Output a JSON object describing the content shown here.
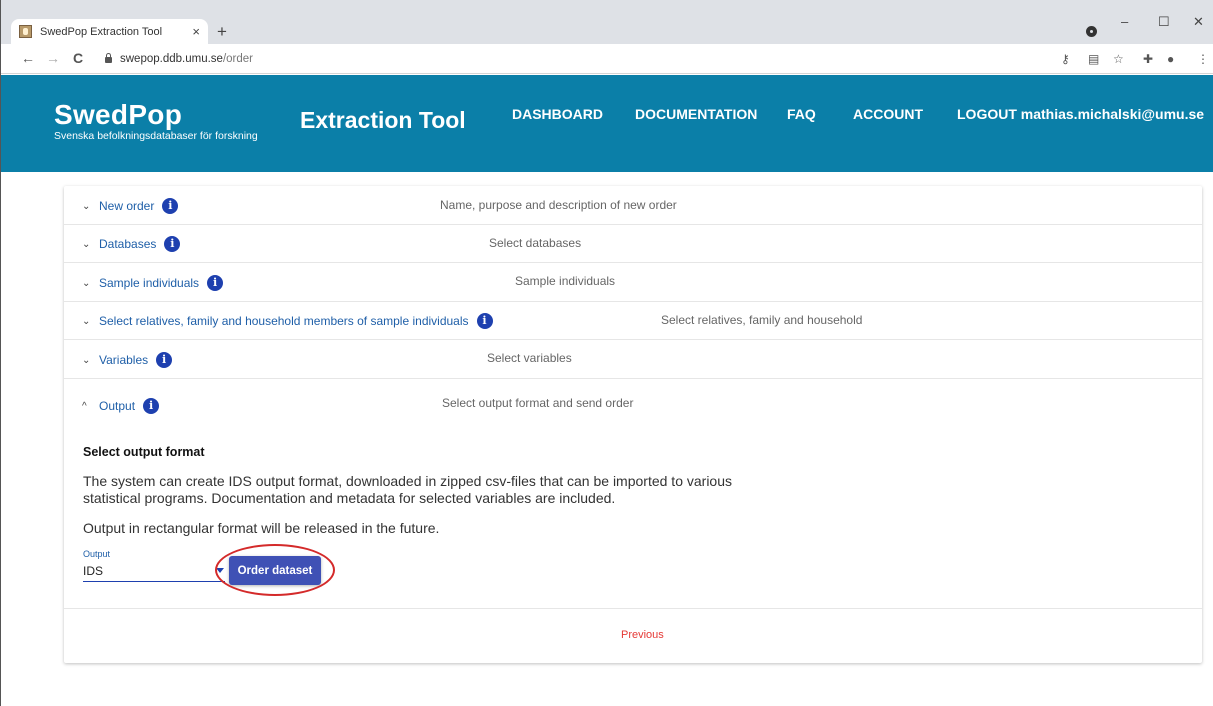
{
  "browser": {
    "tab_title": "SwedPop Extraction Tool",
    "tab_close": "×",
    "new_tab": "+",
    "url_domain": "swepop.ddb.umu.se",
    "url_path": "/order",
    "back": "←",
    "forward": "→",
    "reload": "C",
    "minimize": "–",
    "maximize": "☐",
    "close": "✕"
  },
  "header": {
    "logo_title": "SwedPop",
    "logo_subtitle": "Svenska befolkningsdatabaser för forskning",
    "tool_title": "Extraction Tool",
    "nav": {
      "dashboard": "DASHBOARD",
      "documentation": "DOCUMENTATION",
      "faq": "FAQ",
      "account": "ACCOUNT",
      "logout": "LOGOUT mathias.michalski@umu.se"
    },
    "color": "#0b7fa8"
  },
  "accordion": {
    "new_order": {
      "label": "New order",
      "desc": "Name, purpose and description of new order"
    },
    "databases": {
      "label": "Databases",
      "desc": "Select databases"
    },
    "sample": {
      "label": "Sample individuals",
      "desc": "Sample individuals"
    },
    "relatives": {
      "label": "Select relatives, family and household members of sample individuals",
      "desc": "Select relatives, family and household"
    },
    "variables": {
      "label": "Variables",
      "desc": "Select variables"
    },
    "output": {
      "label": "Output",
      "desc": "Select output format and send order"
    },
    "chevron_down": "⌄",
    "chevron_up": "^",
    "info": "i"
  },
  "output_section": {
    "title": "Select output format",
    "text1": "The system can create IDS output format, downloaded in zipped csv-files that can be imported to various statistical programs. Documentation and metadata for selected variables are included.",
    "text2": "Output in rectangular format will be released in the future.",
    "field_label": "Output",
    "field_value": "IDS",
    "order_button": "Order dataset",
    "previous": "Previous"
  }
}
